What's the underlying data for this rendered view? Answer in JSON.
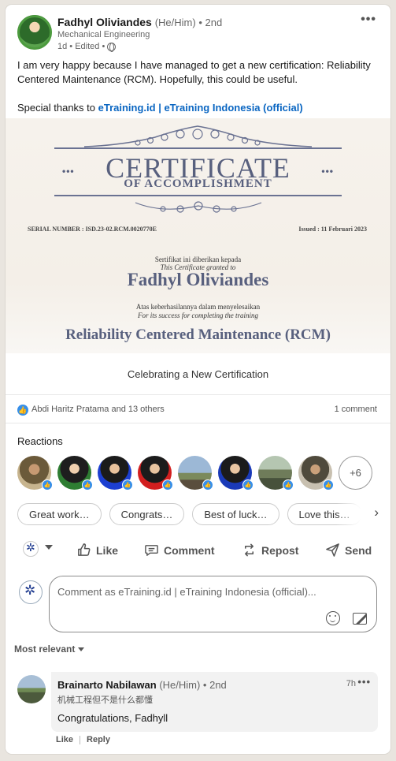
{
  "post": {
    "author_name": "Fadhyl Oliviandes",
    "author_meta": "(He/Him) • 2nd",
    "author_headline": "Mechanical Engineering",
    "post_meta": "1d • Edited •",
    "more_label": "•••",
    "text_line1": "I am very happy because I have managed to get a new certification: Reliability Centered Maintenance (RCM). Hopefully, this could be useful.",
    "text_thanks_prefix": "Special thanks to",
    "text_thanks_link": "eTraining.id | eTraining Indonesia (official)"
  },
  "certificate": {
    "title": "CERTIFICATE",
    "subtitle": "OF ACCOMPLISHMENT",
    "dots": "•••",
    "serial": "SERIAL NUMBER : ISD.23-02.RCM.0020770E",
    "issued": "Issued : 11 Februari 2023",
    "given_id": "Sertifikat ini diberikan kepada",
    "given_en": "This Certificate granted to",
    "recipient": "Fadhyl Oliviandes",
    "success_id": "Atas keberhasilannya dalam menyelesaikan",
    "success_en": "For its success for completing the training",
    "course": "Reliability Centered Maintenance (RCM)"
  },
  "caption": "Celebrating a New Certification",
  "social": {
    "reactors": "Abdi Haritz Pratama and 13 others",
    "comments": "1 comment",
    "reactions_title": "Reactions",
    "more_reactors": "+6"
  },
  "chips": [
    "Great work…",
    "Congrats…",
    "Best of luck…",
    "Love this…"
  ],
  "actions": {
    "like": "Like",
    "comment": "Comment",
    "repost": "Repost",
    "send": "Send"
  },
  "comment_box": {
    "placeholder": "Comment as eTraining.id | eTraining Indonesia (official)..."
  },
  "sort_label": "Most relevant",
  "comment": {
    "author_name": "Brainarto Nabilawan",
    "author_meta": "(He/Him) • 2nd",
    "headline": "机械工程但不是什么都懂",
    "time": "7h",
    "more_label": "•••",
    "text": "Congratulations, Fadhyll",
    "like": "Like",
    "reply": "Reply"
  },
  "colors": {
    "accent": "#0a66c2",
    "like_blue": "#378fe9",
    "certificate_ink": "#58607e"
  }
}
